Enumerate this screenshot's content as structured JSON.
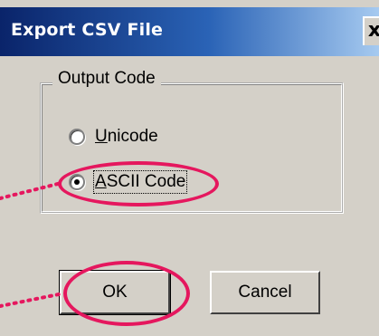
{
  "dialog": {
    "title": "Export CSV File",
    "close_glyph": "x",
    "group_label": "Output Code",
    "options": [
      {
        "label": "Unicode",
        "selected": false
      },
      {
        "label": "ASCII Code",
        "selected": true
      }
    ],
    "buttons": {
      "ok": "OK",
      "cancel": "Cancel"
    }
  },
  "annotation": {
    "color": "#e5175e"
  }
}
